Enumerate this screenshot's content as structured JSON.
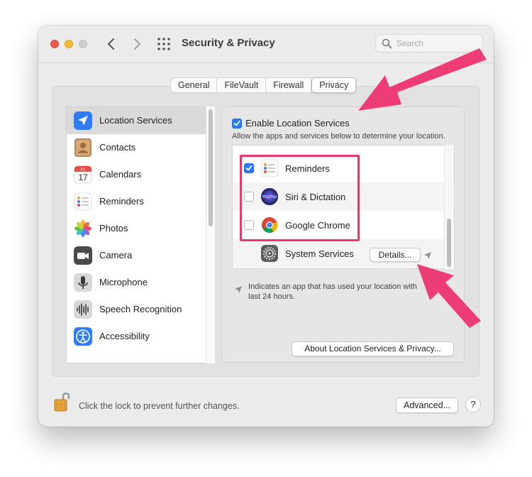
{
  "window": {
    "title": "Security & Privacy",
    "search_placeholder": "Search"
  },
  "tabs": [
    {
      "label": "General",
      "active": false
    },
    {
      "label": "FileVault",
      "active": false
    },
    {
      "label": "Firewall",
      "active": false
    },
    {
      "label": "Privacy",
      "active": true
    }
  ],
  "sidebar": {
    "items": [
      {
        "label": "Location Services",
        "icon": "location-arrow-icon",
        "selected": true
      },
      {
        "label": "Contacts",
        "icon": "contacts-icon",
        "selected": false
      },
      {
        "label": "Calendars",
        "icon": "calendar-icon",
        "selected": false,
        "icon_text_month": "JUL",
        "icon_text_day": "17"
      },
      {
        "label": "Reminders",
        "icon": "reminders-icon",
        "selected": false
      },
      {
        "label": "Photos",
        "icon": "photos-icon",
        "selected": false
      },
      {
        "label": "Camera",
        "icon": "camera-icon",
        "selected": false
      },
      {
        "label": "Microphone",
        "icon": "microphone-icon",
        "selected": false
      },
      {
        "label": "Speech Recognition",
        "icon": "speech-recognition-icon",
        "selected": false
      },
      {
        "label": "Accessibility",
        "icon": "accessibility-icon",
        "selected": false
      }
    ]
  },
  "location": {
    "enable_label": "Enable Location Services",
    "enable_checked": true,
    "description": "Allow the apps and services below to determine your location.",
    "apps": [
      {
        "label": "Reminders",
        "checked": true,
        "icon": "reminders-icon"
      },
      {
        "label": "Siri & Dictation",
        "checked": false,
        "icon": "siri-icon"
      },
      {
        "label": "Google Chrome",
        "checked": false,
        "icon": "chrome-icon"
      }
    ],
    "system_services": {
      "label": "System Services",
      "details_label": "Details...",
      "icon": "gear-icon"
    },
    "note": "Indicates an app that has used your location within the last 24 hours.",
    "note_line1": "Indicates an app that has used your location with",
    "note_line2": "last 24 hours.",
    "about_label": "About Location Services & Privacy..."
  },
  "footer": {
    "lock_text": "Click the lock to prevent further changes.",
    "advanced_label": "Advanced...",
    "help_label": "?"
  },
  "colors": {
    "accent": "#2c7bf6",
    "annotation": "#e9386d"
  }
}
